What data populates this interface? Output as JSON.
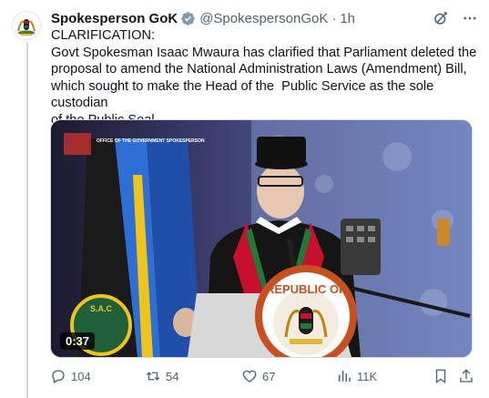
{
  "tweet": {
    "author_name": "Spokesperson GoK",
    "handle": "@SpokespersonGoK",
    "separator": "·",
    "time": "1h",
    "text_lines": [
      "CLARIFICATION:",
      "Govt Spokesman Isaac Mwaura has clarified that Parliament deleted the",
      "proposal to amend the National Administration Laws (Amendment) Bill,",
      "which sought to make the Head of the  Public Service as the sole custodian",
      "of the Public Seal."
    ],
    "video": {
      "duration": "0:37",
      "overlay_caption": "OFFICE OF THE GOVERNMENT SPOKESPERSON",
      "podium_text": "REPUBLIC OF",
      "plaque_text": "S.A.C"
    }
  },
  "actions": {
    "replies": "104",
    "reposts": "54",
    "likes": "67",
    "views": "11K"
  },
  "icons": {
    "verified": "verified-badge-icon",
    "grok": "grok-icon",
    "more": "more-icon",
    "reply": "reply-icon",
    "repost": "repost-icon",
    "like": "like-icon",
    "views": "views-icon",
    "bookmark": "bookmark-icon",
    "share": "share-icon"
  },
  "colors": {
    "text": "#0f1419",
    "muted": "#536471",
    "verified": "#829aab",
    "kenya_green": "#1f7a3a",
    "kenya_red": "#c8102e"
  }
}
